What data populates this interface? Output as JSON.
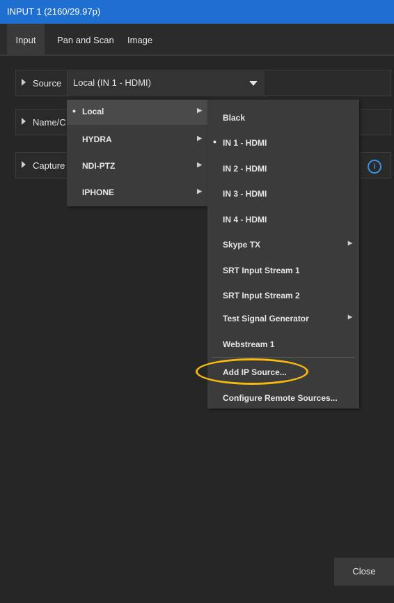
{
  "window": {
    "title": "INPUT 1 (2160/29.97p)"
  },
  "tabs": [
    {
      "label": "Input",
      "active": true
    },
    {
      "label": "Pan and Scan",
      "active": false
    },
    {
      "label": "Image",
      "active": false
    }
  ],
  "rows": {
    "source": {
      "label": "Source",
      "value": "Local (IN 1 - HDMI)"
    },
    "name": {
      "label": "Name/C"
    },
    "capture": {
      "label": "Capture"
    }
  },
  "info_icon": {
    "glyph": "i",
    "color": "#3d8fe0"
  },
  "menu_level1": [
    {
      "label": "Local",
      "selected": true,
      "submenu": true
    },
    {
      "label": "HYDRA",
      "selected": false,
      "submenu": true
    },
    {
      "label": "NDI-PTZ",
      "selected": false,
      "submenu": true
    },
    {
      "label": "IPHONE",
      "selected": false,
      "submenu": true
    }
  ],
  "menu_level2": [
    {
      "label": "Black",
      "selected": false,
      "submenu": false
    },
    {
      "label": "IN 1 - HDMI",
      "selected": true,
      "submenu": false
    },
    {
      "label": "IN 2 - HDMI",
      "selected": false,
      "submenu": false
    },
    {
      "label": "IN 3 - HDMI",
      "selected": false,
      "submenu": false
    },
    {
      "label": "IN 4 - HDMI",
      "selected": false,
      "submenu": false
    },
    {
      "label": "Skype TX",
      "selected": false,
      "submenu": true
    },
    {
      "label": "SRT Input Stream 1",
      "selected": false,
      "submenu": false
    },
    {
      "label": "SRT Input Stream 2",
      "selected": false,
      "submenu": false
    },
    {
      "label": "Test Signal Generator",
      "selected": false,
      "submenu": true
    },
    {
      "label": "Webstream 1",
      "selected": false,
      "submenu": false
    },
    {
      "label": "Add IP Source...",
      "selected": false,
      "submenu": false
    },
    {
      "label": "Configure Remote Sources...",
      "selected": false,
      "submenu": false
    }
  ],
  "footer": {
    "close_label": "Close"
  },
  "colors": {
    "accent": "#1f6fd1",
    "highlight_ring": "#f5b90f"
  }
}
